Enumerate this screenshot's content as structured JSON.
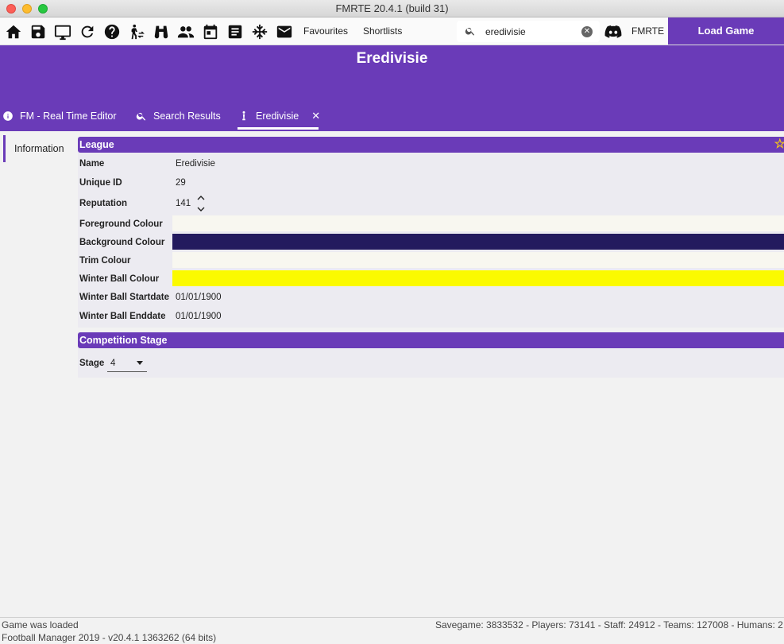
{
  "window": {
    "title": "FMRTE 20.4.1 (build 31)"
  },
  "toolbar": {
    "favourites": "Favourites",
    "shortlists": "Shortlists",
    "search_value": "eredivisie",
    "fmrte_label": "FMRTE",
    "load_game": "Load Game"
  },
  "header": {
    "title": "Eredivisie",
    "tabs": [
      {
        "label": "FM - Real Time Editor",
        "icon": "info-icon"
      },
      {
        "label": "Search Results",
        "icon": "search-icon"
      },
      {
        "label": "Eredivisie",
        "icon": "trophy-icon",
        "close": "✕"
      }
    ]
  },
  "sidebar": {
    "items": [
      {
        "label": "Information"
      }
    ]
  },
  "league": {
    "section_title": "League",
    "star": "☆",
    "name_label": "Name",
    "name_value": "Eredivisie",
    "uid_label": "Unique ID",
    "uid_value": "29",
    "rep_label": "Reputation",
    "rep_value": "141",
    "fg_label": "Foreground Colour",
    "fg_color": "#f8f7f0",
    "bg_label": "Background Colour",
    "bg_color": "#231a5e",
    "trim_label": "Trim Colour",
    "trim_color": "#f8f7f0",
    "winter_label": "Winter Ball Colour",
    "winter_color": "#fbfa00",
    "start_label": "Winter Ball Startdate",
    "start_value": "01/01/1900",
    "end_label": "Winter Ball Enddate",
    "end_value": "01/01/1900"
  },
  "competition": {
    "section_title": "Competition Stage",
    "stage_label": "Stage",
    "stage_value": "4"
  },
  "status": {
    "line1": "Game was loaded",
    "line2": "Football Manager 2019 - v20.4.1 1363262  (64 bits)",
    "right": "Savegame: 3833532 - Players: 73141 - Staff: 24912 - Teams: 127008 - Humans: 2"
  },
  "colors": {
    "accent": "#6a3bb8"
  }
}
